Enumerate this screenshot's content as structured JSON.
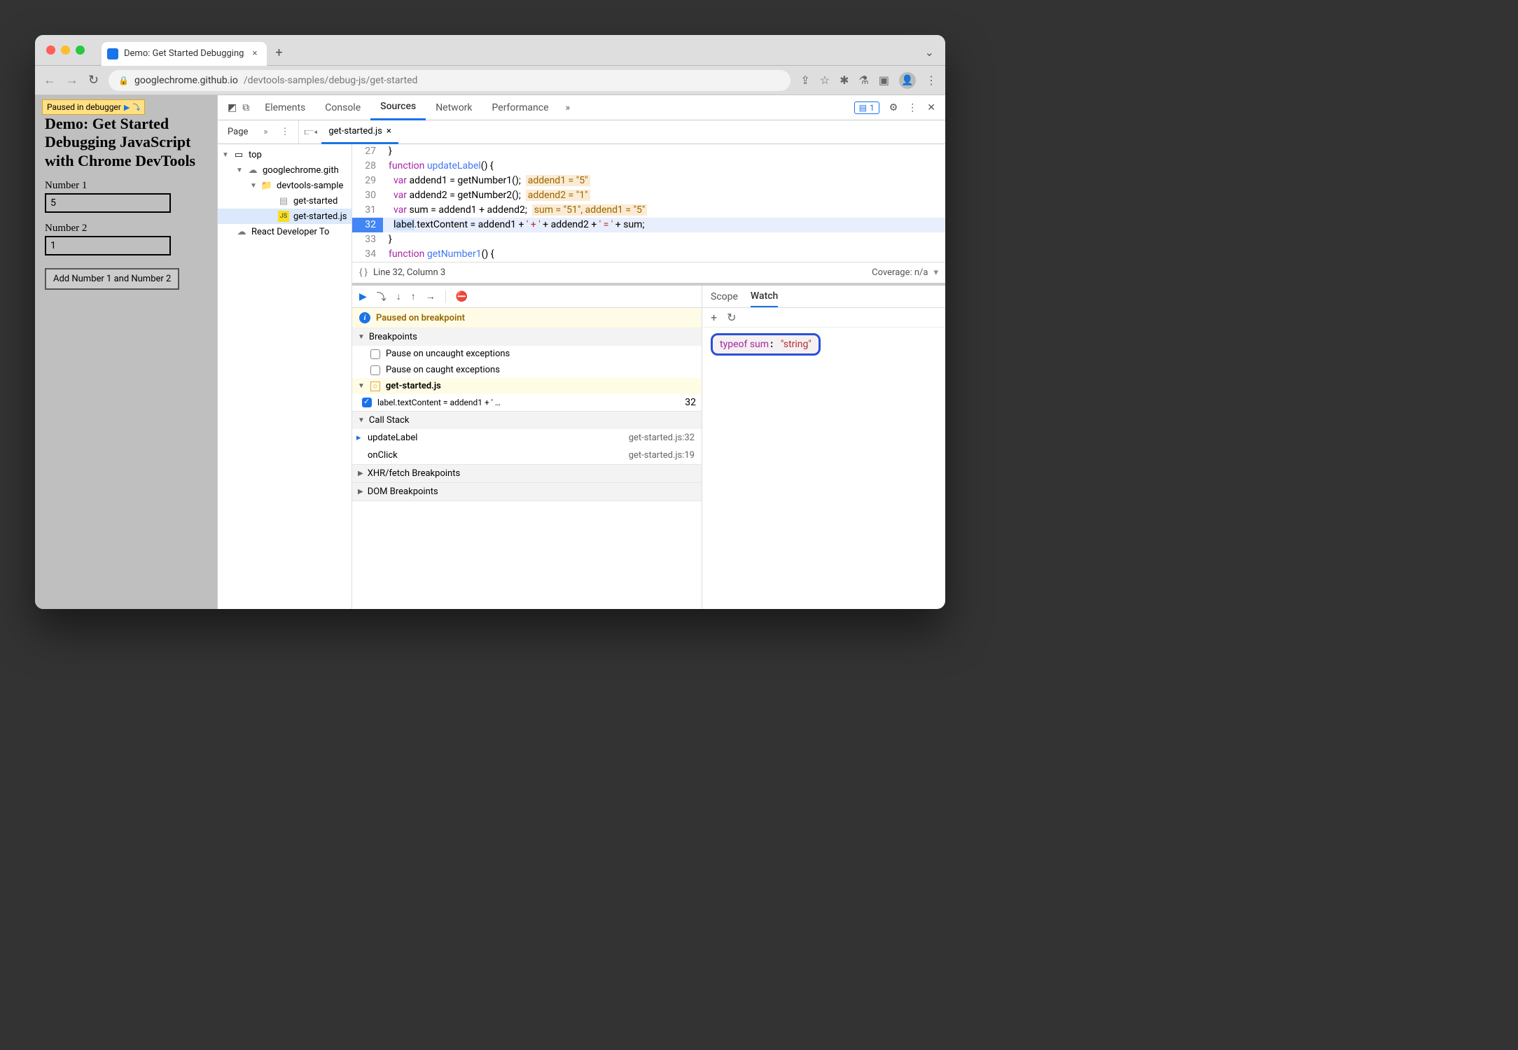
{
  "browser": {
    "tab_title": "Demo: Get Started Debugging",
    "url_host": "googlechrome.github.io",
    "url_path": "/devtools-samples/debug-js/get-started",
    "paused_badge": "Paused in debugger"
  },
  "page": {
    "heading": "Demo: Get Started Debugging JavaScript with Chrome DevTools",
    "label1": "Number 1",
    "value1": "5",
    "label2": "Number 2",
    "value2": "1",
    "button": "Add Number 1 and Number 2"
  },
  "devtools": {
    "tabs": [
      "Elements",
      "Console",
      "Sources",
      "Network",
      "Performance"
    ],
    "active_tab": "Sources",
    "issues_count": "1",
    "sources": {
      "nav_tab": "Page",
      "open_file": "get-started.js",
      "tree": {
        "top": "top",
        "domain": "googlechrome.gith",
        "folder": "devtools-sample",
        "file_html": "get-started",
        "file_js": "get-started.js",
        "ext": "React Developer To"
      },
      "code_lines": [
        {
          "n": "27",
          "t": "}"
        },
        {
          "n": "28",
          "kw": "function ",
          "fn": "updateLabel",
          "rest": "() {"
        },
        {
          "n": "29",
          "ind": "  ",
          "kw": "var ",
          "v": "addend1",
          "rest": " = getNumber1();",
          "hint": "addend1 = \"5\""
        },
        {
          "n": "30",
          "ind": "  ",
          "kw": "var ",
          "v": "addend2",
          "rest": " = getNumber2();",
          "hint": "addend2 = \"1\""
        },
        {
          "n": "31",
          "ind": "  ",
          "kw": "var ",
          "v": "sum",
          "rest": " = addend1 + addend2;",
          "hint": "sum = \"51\", addend1 = \"5\""
        },
        {
          "n": "32",
          "bp": true,
          "ind": "  ",
          "sel": "label",
          "rest2": ".textContent = addend1 + ",
          "s1": "' + '",
          "mid": " + addend2 + ",
          "s2": "' = '",
          "end": " + sum;"
        },
        {
          "n": "33",
          "t": "}"
        },
        {
          "n": "34",
          "kw": "function ",
          "fn": "getNumber1",
          "rest": "() {"
        }
      ],
      "status_line": "Line 32, Column 3",
      "coverage": "Coverage: n/a"
    },
    "debugger": {
      "paused_message": "Paused on breakpoint",
      "sections": {
        "breakpoints": "Breakpoints",
        "pause_uncaught": "Pause on uncaught exceptions",
        "pause_caught": "Pause on caught exceptions",
        "bp_file": "get-started.js",
        "bp_code": "label.textContent = addend1 + ' …",
        "bp_line": "32",
        "call_stack": "Call Stack",
        "stack": [
          {
            "fn": "updateLabel",
            "loc": "get-started.js:32"
          },
          {
            "fn": "onClick",
            "loc": "get-started.js:19"
          }
        ],
        "xhr": "XHR/fetch Breakpoints",
        "dom": "DOM Breakpoints"
      }
    },
    "watch": {
      "tabs": [
        "Scope",
        "Watch"
      ],
      "active": "Watch",
      "expr": "typeof sum",
      "value": "\"string\""
    }
  }
}
